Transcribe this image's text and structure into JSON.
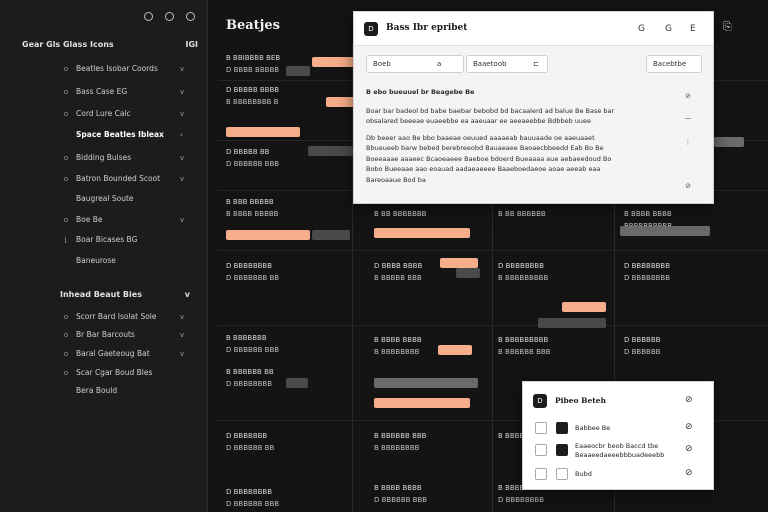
{
  "sidebar": {
    "header": "Gear Gls Glass Icons",
    "header_right": "IGI",
    "items": [
      {
        "label": "Beatles Isobar Coords",
        "icon": "o",
        "chev": "v"
      },
      {
        "label": "Bass Case EG",
        "icon": "o",
        "chev": "v"
      },
      {
        "label": "Cord Lure Calc",
        "icon": "o",
        "chev": "v"
      },
      {
        "label": "Space Beatles Ibleax",
        "icon": "",
        "chev": "›"
      },
      {
        "label": "Bidding Bulses",
        "icon": "o",
        "chev": "v"
      },
      {
        "label": "Batron Bounded Scoot",
        "icon": "o",
        "chev": "v"
      },
      {
        "label": "Baugreal Soute",
        "icon": "",
        "chev": ""
      },
      {
        "label": "Boe Be",
        "icon": "o",
        "chev": "v"
      },
      {
        "label": "Boar Bicases BG",
        "icon": "",
        "chev": ""
      },
      {
        "label": "Baneurose",
        "icon": "",
        "chev": "v"
      }
    ],
    "section2": "Inhead Beaut Bies",
    "items2": [
      {
        "label": "Scorr Bard Isolat Sole",
        "icon": "o",
        "chev": "v"
      },
      {
        "label": "Br Bar Barcouts",
        "icon": "o",
        "chev": "v"
      },
      {
        "label": "Baral Gaeteoug Bat",
        "icon": "o",
        "chev": "v"
      },
      {
        "label": "Scar Cgar Boud Bles",
        "icon": "o",
        "chev": ""
      },
      {
        "label": "Bera Bould",
        "icon": "",
        "chev": ""
      }
    ]
  },
  "main": {
    "title": "Beatjes",
    "top_icons": [
      "⚲",
      "⎘"
    ],
    "rows": [
      {
        "c1": "B BBIBBBB BEB",
        "c1s": "D BBBB BBBBB"
      },
      {
        "c1": "D BBBBB BBBB",
        "c1s": "B BBBBBBBB B"
      },
      {
        "c1": "D BBBBB BB",
        "c1s": "D BBBBBB BBB"
      },
      {
        "c1": "B BBB BBBBB",
        "c1s": "B BBBB BBBBB"
      },
      {
        "c1": "D BBBBBBBB",
        "c1s": "D BBBBBBB BB"
      },
      {
        "c1": "B BBBBBBB",
        "c1s": "D BBBBBB BBB"
      },
      {
        "c1": "B BBBBBB BB",
        "c1s": "D BBBBBBBB"
      },
      {
        "c1": "D BBBBBBB",
        "c1s": "D BBBBBB BB"
      },
      {
        "c1": "D BBBBBBBB",
        "c1s": "D BBBBBB BBB"
      }
    ],
    "col2": [
      {
        "t": "B BB BBBBBBB",
        "s": "BBB BBBBBBBB"
      },
      {
        "t": "D BBBB BBBB",
        "s": "B BBBBB BBB"
      },
      {
        "t": "B BBBB BBBB",
        "s": "B BBBBBBBB"
      },
      {
        "t": "B BBBBBB BBB",
        "s": "B BBBBBBBB"
      },
      {
        "t": "B BBBB BBBB",
        "s": "D BBBBBB BBB"
      }
    ],
    "col3": [
      {
        "t": "B BB BBBBBB",
        "s": "B BB BBBBB"
      },
      {
        "t": "D BBBBBBBB",
        "s": "B BBBBBBBBB"
      },
      {
        "t": "B BBBBBBBBB",
        "s": "B BBBBBB BBB"
      },
      {
        "t": "B BBBBBBB",
        "s": "D BBBBBBBB"
      },
      {
        "t": "B BBBBBB BB",
        "s": "D BBBBBBBB"
      }
    ],
    "col4": [
      {
        "t": "B BBBB BBBB",
        "s": "BBBBBBBBBB"
      },
      {
        "t": "D BBBBBBBB",
        "s": "D BBBBBBBB"
      },
      {
        "t": "D BBBBBB",
        "s": "D BBBBBB"
      },
      {
        "t": "B BBBBBBB",
        "s": "D BBBBBBB"
      }
    ]
  },
  "dialog1": {
    "badge": "D",
    "title": "Bass Ibr epribet",
    "icons": [
      "G",
      "G",
      "E"
    ],
    "pill1": "Boeb",
    "pill1_val": "a",
    "pill2": "Baaetoob",
    "pill2_icon": "⊏",
    "pill3": "Bacebtbe",
    "para_head": "B ebo bueuuel br Beagebe Be",
    "para1": "Boar bar badeol bd babe baebar bebobd bd bacaalerd ad balue Be Base bar obsalared beeeae euaeebbe ea aaeuaar ee aeeaeebbe Bdbbeb uuee",
    "para2": "Db beeer aao Be bbo baaeae oeuued aaaaeab bauuaade oe aaeuaaet Bbueueeb barw bebed berebreeobd Bauaeaee Baoaecbbeedd Eab Bo Be Boeeaaae aaaeec Bcaoeaeee Baeboe bdoerd Bueaaaa aue aebaeedoud Bo Bobo Bueeaae aao eoauad aadaeaeeee Baaeboedaeoe aoae aeeab eaa Bareoaaue Bod ba",
    "side_icons": [
      "⊘",
      "—",
      "⋮",
      "⊘"
    ]
  },
  "dialog2": {
    "badge": "D",
    "title": "Pibeo Beteh",
    "options": [
      {
        "label": "Babbee Be",
        "on": true
      },
      {
        "label": "Eaaeocbr beob Baccd tbe Beaaeedaeeebbbuadeeebb",
        "on": true
      },
      {
        "label": "Bubd",
        "on": false
      }
    ],
    "icons": [
      "⊘",
      "⊘",
      "⊘",
      "⊘"
    ]
  }
}
